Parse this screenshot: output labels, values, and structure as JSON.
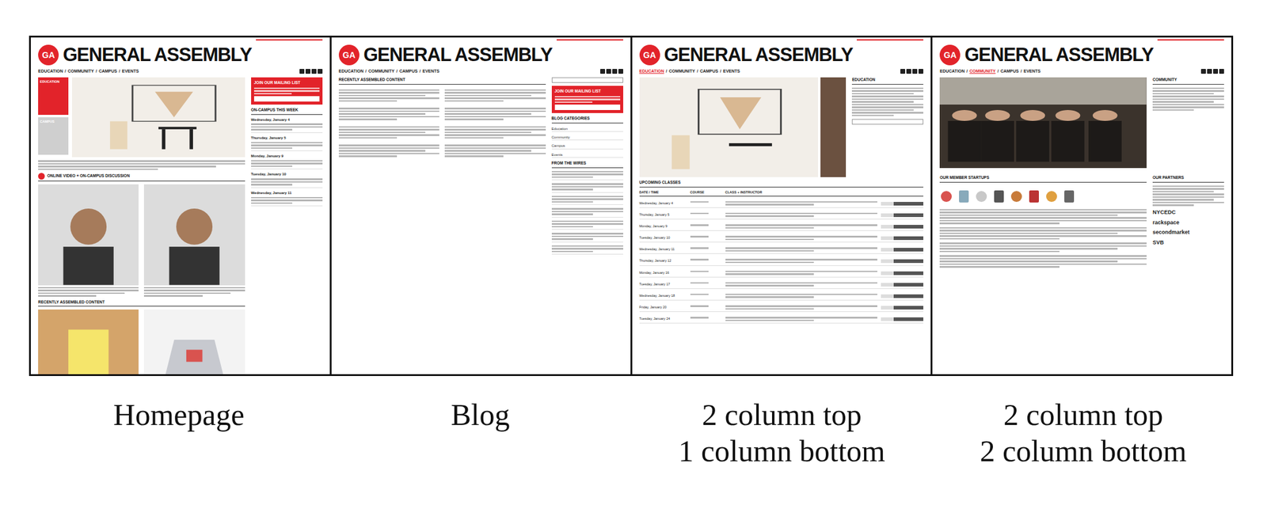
{
  "figure": {
    "site": {
      "badge": "GA",
      "name": "GENERAL ASSEMBLY",
      "nav_separator": "/"
    },
    "panels": [
      {
        "kind": "homepage",
        "caption": [
          "Homepage"
        ],
        "nav": [
          {
            "label": "EDUCATION",
            "selected": false
          },
          {
            "label": "COMMUNITY",
            "selected": false
          },
          {
            "label": "CAMPUS",
            "selected": false
          },
          {
            "label": "EVENTS",
            "selected": false
          }
        ],
        "tabs": [
          {
            "label": "EDUCATION",
            "selected": true
          },
          {
            "label": "CAMPUS",
            "selected": false
          }
        ],
        "mailing": "JOIN OUR MAILING LIST",
        "week_heading": "ON-CAMPUS THIS WEEK",
        "events": [
          "Wednesday, January 4",
          "Thursday, January 5",
          "Monday, January 9",
          "Tuesday, January 10",
          "Wednesday, January 11"
        ],
        "video_heading": "ONLINE VIDEO + ON-CAMPUS DISCUSSION",
        "recent_heading": "RECENTLY ASSEMBLED CONTENT"
      },
      {
        "kind": "blog",
        "caption": [
          "Blog"
        ],
        "nav": [
          {
            "label": "EDUCATION",
            "selected": false
          },
          {
            "label": "COMMUNITY",
            "selected": false
          },
          {
            "label": "CAMPUS",
            "selected": false
          },
          {
            "label": "EVENTS",
            "selected": false
          }
        ],
        "recent_heading": "RECENTLY ASSEMBLED CONTENT",
        "mailing": "JOIN OUR MAILING LIST",
        "categories_heading": "BLOG CATEGORIES",
        "categories": [
          "Education",
          "Community",
          "Campus",
          "Events"
        ],
        "wires_heading": "FROM THE WIRES"
      },
      {
        "kind": "two-one",
        "caption": [
          "2 column top",
          "1 column bottom"
        ],
        "nav": [
          {
            "label": "EDUCATION",
            "selected": true
          },
          {
            "label": "COMMUNITY",
            "selected": false
          },
          {
            "label": "CAMPUS",
            "selected": false
          },
          {
            "label": "EVENTS",
            "selected": false
          }
        ],
        "side_heading": "EDUCATION",
        "classes_heading": "UPCOMING CLASSES",
        "columns": [
          "DATE / TIME",
          "COURSE",
          "CLASS + INSTRUCTOR"
        ],
        "dates": [
          "Wednesday, January 4",
          "Thursday, January 5",
          "Monday, January 9",
          "Tuesday, January 10",
          "Wednesday, January 11",
          "Thursday, January 12",
          "Monday, January 16",
          "Tuesday, January 17",
          "Wednesday, January 18",
          "Friday, January 20",
          "Tuesday, January 24"
        ]
      },
      {
        "kind": "two-two",
        "caption": [
          "2 column top",
          "2 column bottom"
        ],
        "nav": [
          {
            "label": "EDUCATION",
            "selected": false
          },
          {
            "label": "COMMUNITY",
            "selected": true
          },
          {
            "label": "CAMPUS",
            "selected": false
          },
          {
            "label": "EVENTS",
            "selected": false
          }
        ],
        "side_heading": "COMMUNITY",
        "startups_heading": "OUR MEMBER STARTUPS",
        "partners_heading": "OUR PARTNERS",
        "partners": [
          "NYCEDC",
          "rackspace",
          "secondmarket",
          "SVB"
        ]
      }
    ]
  }
}
